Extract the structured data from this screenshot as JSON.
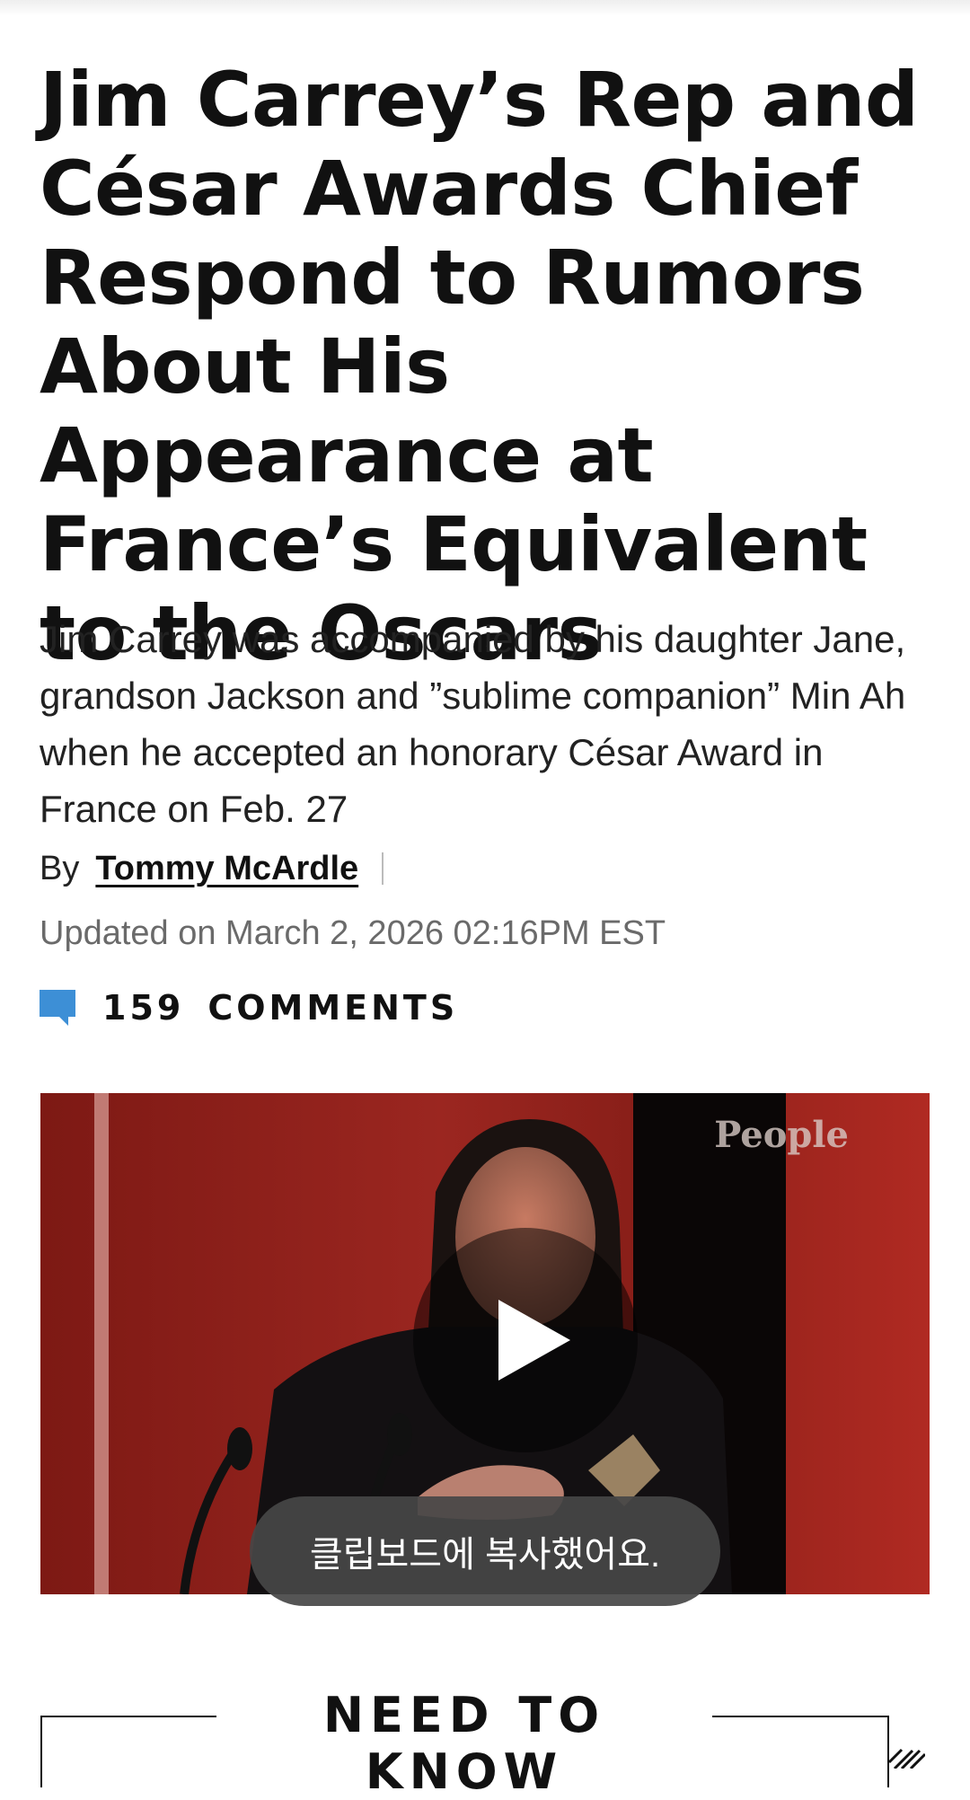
{
  "article": {
    "headline": "Jim Carrey’s Rep and César Awards Chief Respond to Rumors About His Appearance at France’s Equivalent to the Oscars",
    "dek": "Jim Carrey was accompanied by his daughter Jane, grandson Jackson and ”sublime companion” Min Ah when he accepted an honorary César Award in France on Feb. 27",
    "byline_prefix": "By",
    "author": "Tommy McArdle",
    "updated": "Updated on March 2, 2026 02:16PM EST",
    "comments_count": "159",
    "comments_label": "COMMENTS"
  },
  "video": {
    "watermark": "People",
    "play_icon": "play-icon"
  },
  "toast": {
    "message": "클립보드에 복사했어요."
  },
  "need_to_know": {
    "title": "NEED TO KNOW"
  },
  "colors": {
    "comment_icon": "#3d8fd6",
    "video_bg": "#8e1f1a",
    "toast_bg": "#464646"
  }
}
